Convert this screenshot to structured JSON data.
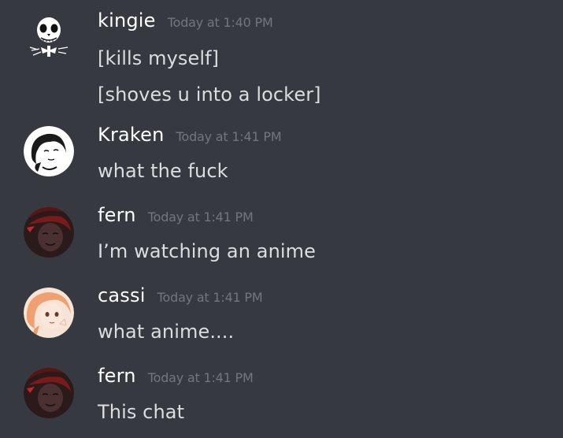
{
  "messages": [
    {
      "username": "kingie",
      "timestamp": "Today at 1:40 PM",
      "avatar_icon": "skull-avatar-icon",
      "lines": [
        "[kills myself]",
        "[shoves u into a locker]"
      ]
    },
    {
      "username": "Kraken",
      "timestamp": "Today at 1:41 PM",
      "avatar_icon": "sketch-face-avatar-icon",
      "lines": [
        "what the fuck"
      ]
    },
    {
      "username": "fern",
      "timestamp": "Today at 1:41 PM",
      "avatar_icon": "dark-red-face-avatar-icon",
      "lines": [
        "I’m watching an anime"
      ]
    },
    {
      "username": "cassi",
      "timestamp": "Today at 1:41 PM",
      "avatar_icon": "anime-girl-avatar-icon",
      "lines": [
        "what anime...."
      ]
    },
    {
      "username": "fern",
      "timestamp": "Today at 1:41 PM",
      "avatar_icon": "dark-red-face-avatar-icon",
      "lines": [
        "This chat"
      ]
    }
  ],
  "colors": {
    "background": "#36393f",
    "username": "#ffffff",
    "message_text": "#dcddde",
    "timestamp": "#72767d"
  }
}
